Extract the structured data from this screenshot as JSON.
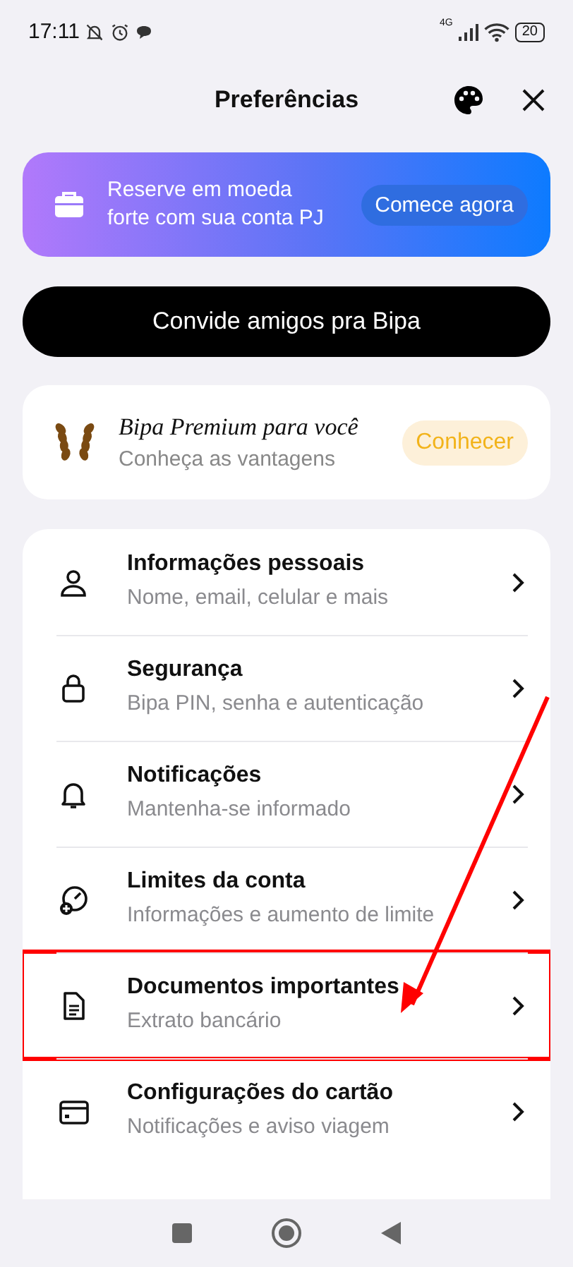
{
  "status_bar": {
    "time": "17:11",
    "network": "4G",
    "battery": "20"
  },
  "header": {
    "title": "Preferências"
  },
  "promo": {
    "text": "Reserve em moeda forte com sua conta PJ",
    "button": "Comece agora"
  },
  "invite_button": "Convide amigos pra Bipa",
  "premium": {
    "title": "Bipa Premium para você",
    "subtitle": "Conheça as vantagens",
    "button": "Conhecer"
  },
  "menu": [
    {
      "kind": "person",
      "title": "Informações pessoais",
      "subtitle": "Nome, email, celular e mais",
      "highlighted": false
    },
    {
      "kind": "lock",
      "title": "Segurança",
      "subtitle": "Bipa PIN, senha e autenticação",
      "highlighted": false
    },
    {
      "kind": "bell",
      "title": "Notificações",
      "subtitle": "Mantenha-se informado",
      "highlighted": false
    },
    {
      "kind": "gauge",
      "title": "Limites da conta",
      "subtitle": "Informações e aumento de limite",
      "highlighted": false
    },
    {
      "kind": "document",
      "title": "Documentos importantes",
      "subtitle": "Extrato bancário",
      "highlighted": true
    },
    {
      "kind": "card",
      "title": "Configurações do cartão",
      "subtitle": "Notificações e aviso viagem",
      "highlighted": false
    }
  ]
}
